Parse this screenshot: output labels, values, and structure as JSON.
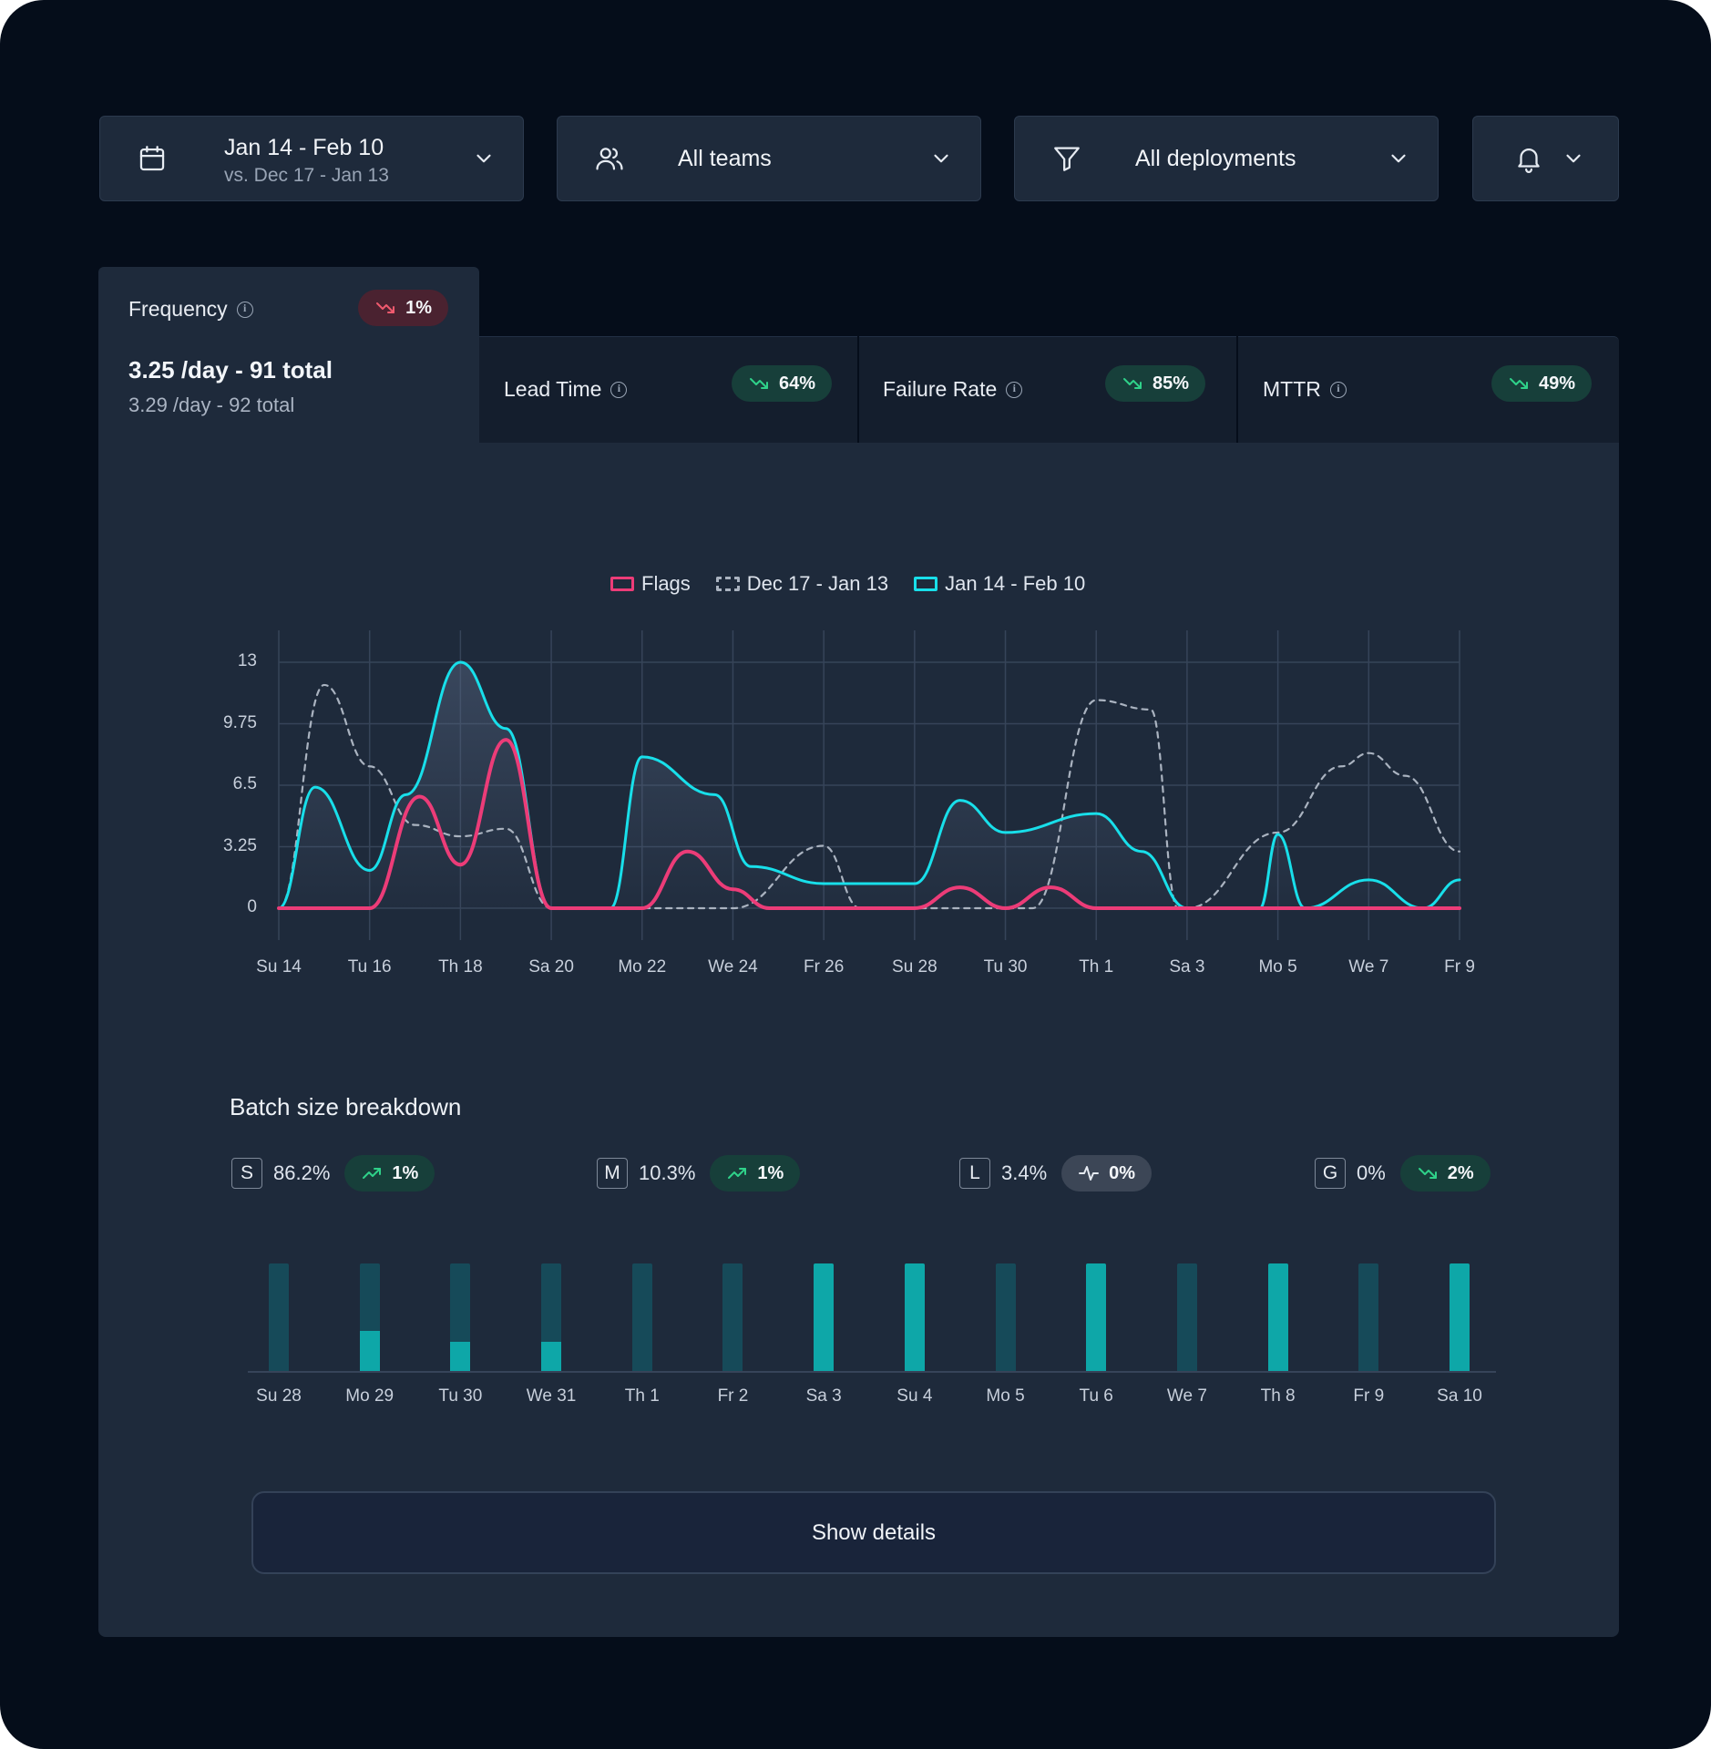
{
  "filters": {
    "date": {
      "title": "Jan 14 - Feb 10",
      "subtitle": "vs. Dec 17 - Jan 13",
      "icon": "calendar-icon"
    },
    "teams": {
      "title": "All teams",
      "icon": "users-icon"
    },
    "deployments": {
      "title": "All deployments",
      "icon": "filter-icon"
    },
    "alerts": {
      "icon": "bell-icon"
    }
  },
  "tabs": [
    {
      "label": "Frequency",
      "badge": "1%",
      "trend": "down",
      "badge_color": "red",
      "value": "3.25 /day - 91 total",
      "previous": "3.29 /day - 92 total"
    },
    {
      "label": "Lead Time",
      "badge": "64%",
      "trend": "down",
      "badge_color": "green"
    },
    {
      "label": "Failure Rate",
      "badge": "85%",
      "trend": "down",
      "badge_color": "green"
    },
    {
      "label": "MTTR",
      "badge": "49%",
      "trend": "down",
      "badge_color": "green"
    }
  ],
  "legend": {
    "flags": "Flags",
    "previous": "Dec 17 - Jan 13",
    "current": "Jan 14 - Feb 10"
  },
  "colors": {
    "flags": "#ec3c78",
    "current": "#18dfea",
    "previous": "#aab3c0",
    "bar_light": "#0ea7a8",
    "bar_dark": "#164a59"
  },
  "chart_data": {
    "type": "line",
    "x": [
      "Su 14",
      "Tu 16",
      "Th 18",
      "Sa 20",
      "Mo 22",
      "We 24",
      "Fr 26",
      "Su 28",
      "Tu 30",
      "Th 1",
      "Sa 3",
      "Mo 5",
      "We 7",
      "Fr 9"
    ],
    "ylim": [
      0,
      13
    ],
    "yticks": [
      "13",
      "9.75",
      "6.5",
      "3.25",
      "0"
    ],
    "grid": true,
    "legend_position": "top",
    "series": [
      {
        "name": "Dec 17 - Jan 13",
        "style": "dashed",
        "points": [
          [
            0,
            0
          ],
          [
            0.5,
            11.8
          ],
          [
            1,
            7.5
          ],
          [
            1.5,
            4.4
          ],
          [
            2,
            3.8
          ],
          [
            2.5,
            4.2
          ],
          [
            3,
            0
          ],
          [
            4,
            0
          ],
          [
            5,
            0
          ],
          [
            6,
            3.3
          ],
          [
            6.4,
            0
          ],
          [
            7,
            0
          ],
          [
            8.3,
            0
          ],
          [
            9,
            11
          ],
          [
            9.6,
            10.5
          ],
          [
            9.9,
            0
          ],
          [
            10,
            0
          ],
          [
            11,
            4
          ],
          [
            11.7,
            7.5
          ],
          [
            12,
            8.2
          ],
          [
            12.4,
            7
          ],
          [
            13,
            3
          ]
        ]
      },
      {
        "name": "Jan 14 - Feb 10",
        "style": "solid",
        "points": [
          [
            0,
            0
          ],
          [
            0.4,
            6.4
          ],
          [
            1,
            2
          ],
          [
            1.4,
            6
          ],
          [
            2,
            13
          ],
          [
            2.5,
            9.5
          ],
          [
            3,
            0
          ],
          [
            3.65,
            0
          ],
          [
            4,
            8
          ],
          [
            4.8,
            6
          ],
          [
            5.2,
            2.2
          ],
          [
            6,
            1.3
          ],
          [
            7,
            1.3
          ],
          [
            7.5,
            5.7
          ],
          [
            8,
            4
          ],
          [
            9,
            5
          ],
          [
            9.5,
            3
          ],
          [
            10,
            0
          ],
          [
            10.5,
            0
          ],
          [
            10.8,
            0
          ],
          [
            11,
            3.9
          ],
          [
            11.3,
            0
          ],
          [
            12,
            1.5
          ],
          [
            12.6,
            0
          ],
          [
            13,
            1.5
          ]
        ]
      },
      {
        "name": "Flags",
        "style": "solid",
        "points": [
          [
            0,
            0
          ],
          [
            1,
            0
          ],
          [
            1.55,
            5.9
          ],
          [
            2,
            2.3
          ],
          [
            2.5,
            8.9
          ],
          [
            3,
            0
          ],
          [
            4,
            0
          ],
          [
            4.5,
            3
          ],
          [
            5,
            1
          ],
          [
            5.4,
            0
          ],
          [
            7,
            0
          ],
          [
            7.5,
            1.1
          ],
          [
            8,
            0
          ],
          [
            8.5,
            1.1
          ],
          [
            9,
            0
          ],
          [
            13,
            0
          ]
        ]
      }
    ]
  },
  "batch": {
    "title": "Batch size breakdown",
    "items": [
      {
        "key": "S",
        "pct": "86.2%",
        "badge": "1%",
        "trend": "up",
        "color": "green"
      },
      {
        "key": "M",
        "pct": "10.3%",
        "badge": "1%",
        "trend": "up",
        "color": "green"
      },
      {
        "key": "L",
        "pct": "3.4%",
        "badge": "0%",
        "trend": "flat",
        "color": "grey"
      },
      {
        "key": "G",
        "pct": "0%",
        "badge": "2%",
        "trend": "down",
        "color": "green"
      }
    ],
    "bars": [
      {
        "label": "Su 28",
        "fill": 0,
        "bright": false
      },
      {
        "label": "Mo 29",
        "fill": 0.37,
        "bright": false
      },
      {
        "label": "Tu 30",
        "fill": 0.27,
        "bright": false
      },
      {
        "label": "We 31",
        "fill": 0.27,
        "bright": false
      },
      {
        "label": "Th 1",
        "fill": 0,
        "bright": false
      },
      {
        "label": "Fr 2",
        "fill": 0,
        "bright": false
      },
      {
        "label": "Sa 3",
        "fill": 1,
        "bright": true
      },
      {
        "label": "Su 4",
        "fill": 1,
        "bright": true
      },
      {
        "label": "Mo 5",
        "fill": 0,
        "bright": false
      },
      {
        "label": "Tu 6",
        "fill": 1,
        "bright": true
      },
      {
        "label": "We 7",
        "fill": 0,
        "bright": false
      },
      {
        "label": "Th 8",
        "fill": 1,
        "bright": true
      },
      {
        "label": "Fr 9",
        "fill": 0,
        "bright": false
      },
      {
        "label": "Sa 10",
        "fill": 1,
        "bright": true
      }
    ]
  },
  "show_details": "Show details"
}
